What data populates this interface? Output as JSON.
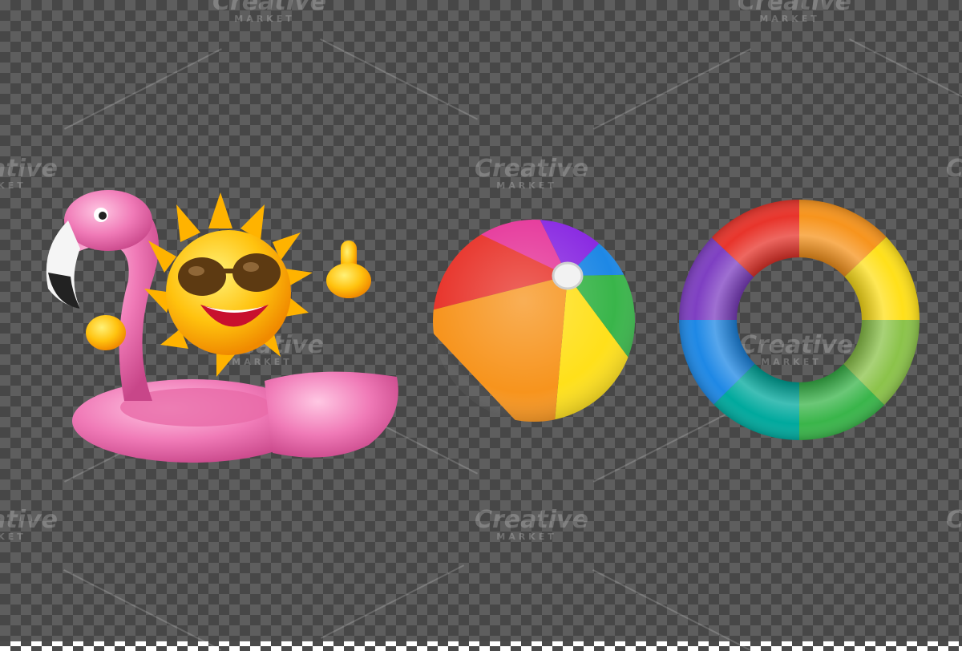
{
  "watermark": {
    "brand_word": "Creative",
    "sub_word": "MARKET"
  },
  "objects": [
    {
      "icon": "flamingo-float-with-sun-icon"
    },
    {
      "icon": "beach-ball-icon"
    },
    {
      "icon": "rainbow-swim-ring-icon"
    }
  ],
  "colors": {
    "flamingo_pink": "#f07ab7",
    "sun_yellow": "#ffc20e",
    "ring_colors": [
      "#e8342b",
      "#f7941d",
      "#ffe01a",
      "#39b54a",
      "#1e88e5",
      "#7e3fc2"
    ]
  }
}
